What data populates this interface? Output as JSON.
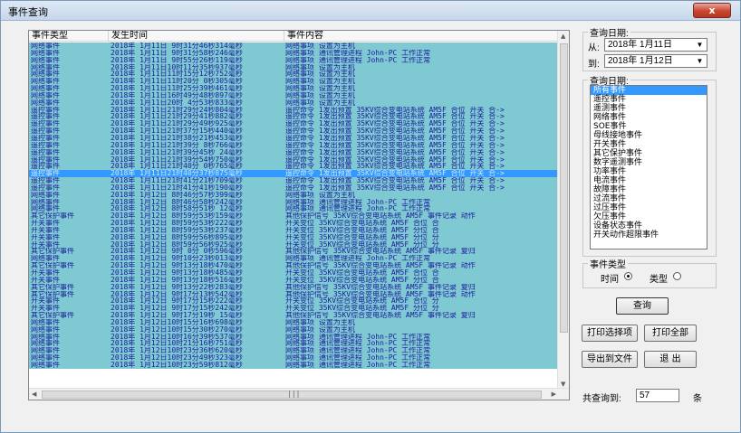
{
  "window": {
    "title": "事件查询",
    "close_label": "x"
  },
  "columns": [
    "事件类型",
    "发生时间",
    "事件内容"
  ],
  "rows": [
    [
      "网络事件",
      "2018年 1月11日 9时31分46秒314毫秒",
      "网络事项  设置为主机"
    ],
    [
      "网络事件",
      "2018年 1月11日 9时31分58秒246毫秒",
      "网络事项 通讯管理进程 John-PC 工作正常"
    ],
    [
      "网络事件",
      "2018年 1月11日 9时55分26秒119毫秒",
      "网络事项 通讯管理进程 John-PC 工作正常"
    ],
    [
      "网络事件",
      "2018年 1月11日10时11分35秒937毫秒",
      "网络事项  设置为主机"
    ],
    [
      "网络事件",
      "2018年 1月11日11时15分12秒752毫秒",
      "网络事项  设置为主机"
    ],
    [
      "网络事件",
      "2018年 1月11日11时20分 0秒305毫秒",
      "网络事项  设置为主机"
    ],
    [
      "网络事件",
      "2018年 1月11日11时25分39秒461毫秒",
      "网络事项  设置为主机"
    ],
    [
      "网络事件",
      "2018年 1月11日16时49分48秒897毫秒",
      "网络事项  设置为主机"
    ],
    [
      "网络事件",
      "2018年 1月11日20时 4分53秒833毫秒",
      "网络事项  设置为主机"
    ],
    [
      "遥控事件",
      "2018年 1月11日21时29分24秒804毫秒",
      "遥控命令  1发出预置  35KV综合变电站系统 AM5F 合位 开关 合->"
    ],
    [
      "遥控事件",
      "2018年 1月11日21时29分41秒882毫秒",
      "遥控命令  1发出预置  35KV综合变电站系统 AM5F 合位 开关 合->"
    ],
    [
      "遥控事件",
      "2018年 1月11日21时29分49秒925毫秒",
      "遥控命令  1发出预置  35KV综合变电站系统 AM5F 合位 开关 合->"
    ],
    [
      "遥控事件",
      "2018年 1月11日21时37分15秒440毫秒",
      "遥控命令  1发出预置  35KV综合变电站系统 AM5F 合位 开关 合->"
    ],
    [
      "遥控事件",
      "2018年 1月11日21时38分21秒453毫秒",
      "遥控命令  1发出预置  35KV综合变电站系统 AM5F 合位 开关 合->"
    ],
    [
      "遥控事件",
      "2018年 1月11日21时39分 8秒766毫秒",
      "遥控命令  1发出预置  35KV综合变电站系统 AM5F 合位 开关 合->"
    ],
    [
      "遥控事件",
      "2018年 1月11日21时39分45秒 24毫秒",
      "遥控命令  1发出预置  35KV综合变电站系统 AM5F 合位 开关 合->"
    ],
    [
      "遥控事件",
      "2018年 1月11日21时39分54秒750毫秒",
      "遥控命令  1发出预置  35KV综合变电站系统 AM5F 合位 开关 合->"
    ],
    [
      "遥控事件",
      "2018年 1月11日21时40分 0秒765毫秒",
      "遥控命令  1发出预置  35KV综合变电站系统 AM5F 合位 开关 合->"
    ],
    [
      "遥控事件",
      "2018年 1月11日21时40分37秒875毫秒",
      "遥控命令  1发出预置  35KV综合变电站系统 AM5F 合位 开关 合->"
    ],
    [
      "遥控事件",
      "2018年 1月11日21时41分21秒709毫秒",
      "遥控命令  1发出预置  35KV综合变电站系统 AM5F 合位 开关 合->"
    ],
    [
      "遥控事件",
      "2018年 1月11日21时41分41秒190毫秒",
      "遥控命令  1发出预置  35KV综合变电站系统 AM5F 合位 开关 合->"
    ],
    [
      "网络事件",
      "2018年 1月12日 8时46分57秒399毫秒",
      "网络事项  设置为主机"
    ],
    [
      "网络事件",
      "2018年 1月12日 8时46分58秒242毫秒",
      "网络事项 通讯管理进程 John-PC 工作正常"
    ],
    [
      "网络事件",
      "2018年 1月12日 8时58分51秒 12毫秒",
      "网络事项 通讯管理进程 John-PC 工作正常"
    ],
    [
      "其它保护事件",
      "2018年 1月12日 8时59分53秒159毫秒",
      "其他保护信号  35KV综合变电站系统 AM5F 事件记录  动作"
    ],
    [
      "开关事件",
      "2018年 1月12日 8时59分53秒222毫秒",
      "开关变位  35KV综合变电站系统 AM5F 合位  合"
    ],
    [
      "开关事件",
      "2018年 1月12日 8时59分53秒237毫秒",
      "开关变位  35KV综合变电站系统 AM5F 分位  合"
    ],
    [
      "开关事件",
      "2018年 1月12日 8时59分56秒895毫秒",
      "开关变位  35KV综合变电站系统 AM5F 分位  分"
    ],
    [
      "开关事件",
      "2018年 1月12日 8时59分56秒925毫秒",
      "开关变位  35KV综合变电站系统 AM5F 分位  分"
    ],
    [
      "其它保护事件",
      "2018年 1月12日 9时 0分 0秒596毫秒",
      "其他保护信号  35KV综合变电站系统 AM5F 事件记录  复归"
    ],
    [
      "网络事件",
      "2018年 1月12日 9时10分23秒013毫秒",
      "网络事项 通讯管理进程 John-PC 工作正常"
    ],
    [
      "其它保护事件",
      "2018年 1月12日 9时13分18秒470毫秒",
      "其他保护信号  35KV综合变电站系统 AM5F 事件记录  动作"
    ],
    [
      "开关事件",
      "2018年 1月12日 9时13分18秒485毫秒",
      "开关变位  35KV综合变电站系统 AM5F 合位  合"
    ],
    [
      "开关事件",
      "2018年 1月12日 9时13分18秒516毫秒",
      "开关变位  35KV综合变电站系统 AM5F 分位  合"
    ],
    [
      "其它保护事件",
      "2018年 1月12日 9时13分22秒283毫秒",
      "其他保护信号  35KV综合变电站系统 AM5F 事件记录  复归"
    ],
    [
      "其它保护事件",
      "2018年 1月12日 9时17分13秒542毫秒",
      "其他保护信号  35KV综合变电站系统 AM5F 事件记录  动作"
    ],
    [
      "开关事件",
      "2018年 1月12日 9时17分15秒222毫秒",
      "开关变位  35KV综合变电站系统 AM5F 合位  分"
    ],
    [
      "开关事件",
      "2018年 1月12日 9时17分15秒242毫秒",
      "开关变位  35KV综合变电站系统 AM5F 分位  分"
    ],
    [
      "其它保护事件",
      "2018年 1月12日 9时17分19秒 15毫秒",
      "其他保护信号  35KV综合变电站系统 AM5F 事件记录  复归"
    ],
    [
      "网络事件",
      "2018年 1月12日10时15分16秒698毫秒",
      "网络事项  设置为主机"
    ],
    [
      "网络事件",
      "2018年 1月12日10时15分30秒270毫秒",
      "网络事项  设置为主机"
    ],
    [
      "网络事件",
      "2018年 1月12日10时16分39秒537毫秒",
      "网络事项 通讯管理进程 John-PC 工作正常"
    ],
    [
      "网络事件",
      "2018年 1月12日10时21分16秒751毫秒",
      "网络事项 通讯管理进程 John-PC 工作正常"
    ],
    [
      "网络事件",
      "2018年 1月12日10时23分36秒620毫秒",
      "网络事项 通讯管理进程 John-PC 工作正常"
    ],
    [
      "网络事件",
      "2018年 1月12日10时23分49秒323毫秒",
      "网络事项 通讯管理进程 John-PC 工作正常"
    ],
    [
      "网络事件",
      "2018年 1月12日10时23分59秒812毫秒",
      "网络事项 通讯管理进程 John-PC 工作正常"
    ]
  ],
  "selected_row": 18,
  "query_date": {
    "group_label": "查询日期:",
    "from_label": "从:",
    "from_value": "2018年 1月11日",
    "to_label": "到:",
    "to_value": "2018年 1月12日"
  },
  "query_type": {
    "group_label": "查询日期:",
    "items": [
      "所有事件",
      "遥控事件",
      "遥测事件",
      "网络事件",
      "SOE事件",
      "母线接地事件",
      "开关事件",
      "其它保护事件",
      "数字遥测事件",
      "功率事件",
      "电流事件",
      "故障事件",
      "过流事件",
      "过压事件",
      "欠压事件",
      "设备状态事件",
      "开关动作超限事件"
    ],
    "selected": 0
  },
  "event_type": {
    "group_label": "事件类型",
    "time_label": "时间",
    "type_label": "类型",
    "selected": "time"
  },
  "buttons": {
    "query": "查询",
    "print_selected": "打印选择项",
    "print_all": "打印全部",
    "export": "导出到文件",
    "exit": "退 出"
  },
  "count": {
    "label": "共查询到:",
    "value": "57",
    "unit": "条"
  },
  "scroll_hint": "|||"
}
